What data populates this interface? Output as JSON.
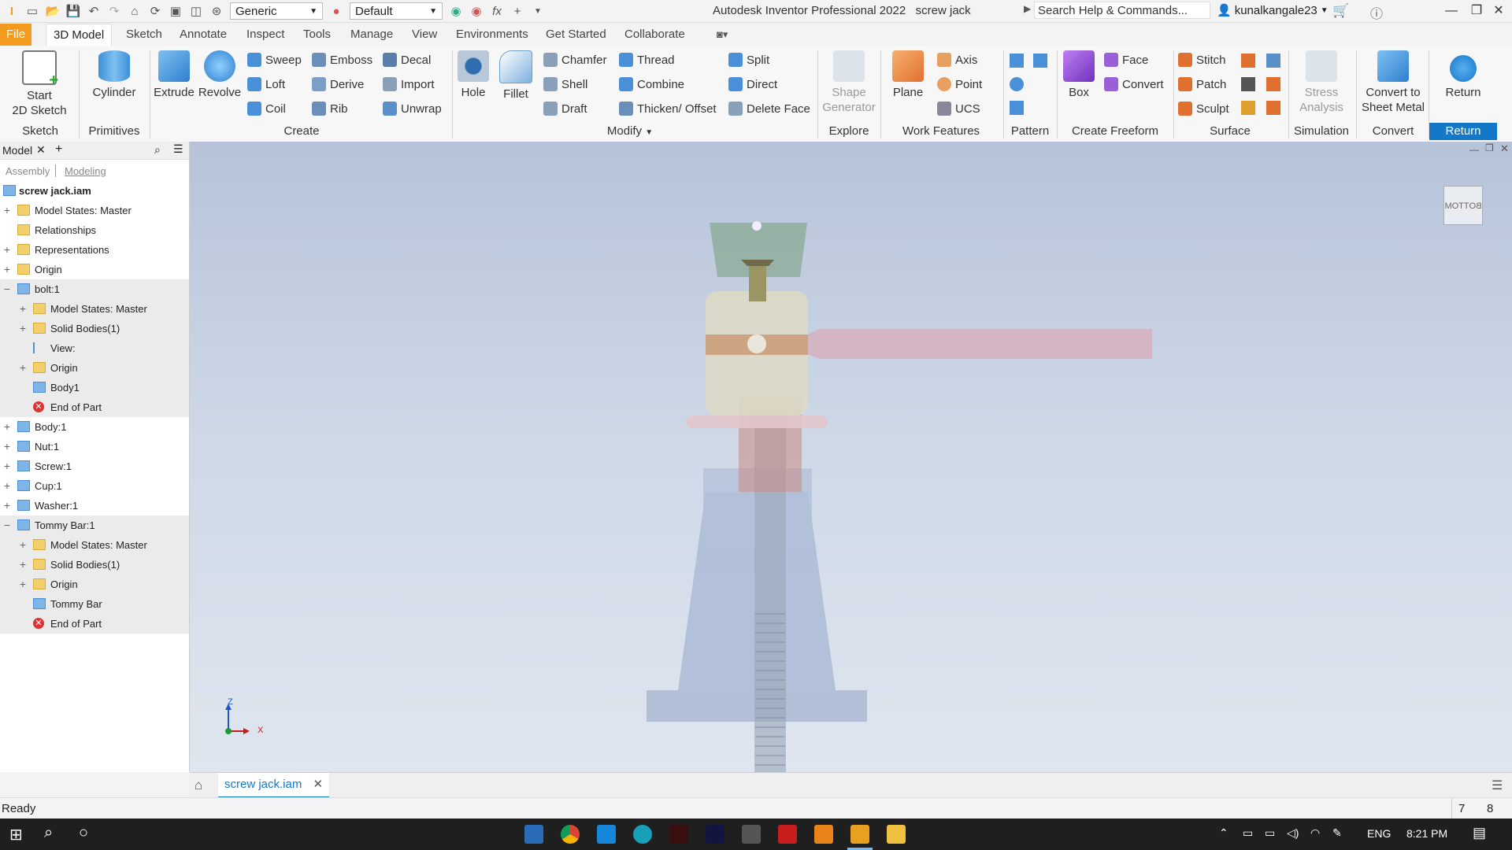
{
  "title_bar": {
    "material": "Generic",
    "appearance": "Default",
    "app_title": "Autodesk Inventor Professional 2022",
    "document": "screw jack",
    "search_placeholder": "Search Help & Commands...",
    "user": "kunalkangale23",
    "fx": "fx"
  },
  "menu_tabs": [
    "File",
    "3D Model",
    "Sketch",
    "Annotate",
    "Inspect",
    "Tools",
    "Manage",
    "View",
    "Environments",
    "Get Started",
    "Collaborate"
  ],
  "active_tab": "3D Model",
  "ribbon": {
    "sketch": {
      "start_sketch_line1": "Start",
      "start_sketch_line2": "2D Sketch",
      "group": "Sketch"
    },
    "primitives": {
      "cylinder": "Cylinder",
      "group": "Primitives"
    },
    "create": {
      "extrude": "Extrude",
      "revolve": "Revolve",
      "sweep": "Sweep",
      "emboss": "Emboss",
      "decal": "Decal",
      "loft": "Loft",
      "derive": "Derive",
      "import": "Import",
      "coil": "Coil",
      "rib": "Rib",
      "unwrap": "Unwrap",
      "group": "Create"
    },
    "modify": {
      "hole": "Hole",
      "fillet": "Fillet",
      "chamfer": "Chamfer",
      "thread": "Thread",
      "split": "Split",
      "shell": "Shell",
      "combine": "Combine",
      "direct": "Direct",
      "draft": "Draft",
      "thicken": "Thicken/ Offset",
      "delete_face": "Delete Face",
      "group": "Modify"
    },
    "explore": {
      "shape_gen_1": "Shape",
      "shape_gen_2": "Generator",
      "group": "Explore"
    },
    "work_features": {
      "plane": "Plane",
      "axis": "Axis",
      "point": "Point",
      "ucs": "UCS",
      "group": "Work Features"
    },
    "pattern": {
      "group": "Pattern"
    },
    "freeform": {
      "box": "Box",
      "face": "Face",
      "convert": "Convert",
      "group": "Create Freeform"
    },
    "surface": {
      "stitch": "Stitch",
      "patch": "Patch",
      "sculpt": "Sculpt",
      "group": "Surface"
    },
    "simulation": {
      "stress_1": "Stress",
      "stress_2": "Analysis",
      "group": "Simulation"
    },
    "convert": {
      "line1": "Convert to",
      "line2": "Sheet Metal",
      "group": "Convert"
    },
    "return": {
      "label": "Return",
      "group": "Return"
    }
  },
  "browser": {
    "tab": "Model",
    "sub_assembly": "Assembly",
    "sub_modeling": "Modeling",
    "root": "screw jack.iam",
    "items": [
      {
        "label": "Model States: Master",
        "level": 0,
        "exp": "+",
        "icon": "folder"
      },
      {
        "label": "Relationships",
        "level": 0,
        "exp": "",
        "icon": "folder"
      },
      {
        "label": "Representations",
        "level": 0,
        "exp": "+",
        "icon": "folder"
      },
      {
        "label": "Origin",
        "level": 0,
        "exp": "+",
        "icon": "folder"
      },
      {
        "label": "bolt:1",
        "level": 0,
        "exp": "−",
        "icon": "part"
      },
      {
        "label": "Model States: Master",
        "level": 1,
        "exp": "+",
        "icon": "folder"
      },
      {
        "label": "Solid Bodies(1)",
        "level": 1,
        "exp": "+",
        "icon": "folder"
      },
      {
        "label": "View:",
        "level": 1,
        "exp": "",
        "icon": "view"
      },
      {
        "label": "Origin",
        "level": 1,
        "exp": "+",
        "icon": "folder"
      },
      {
        "label": "Body1",
        "level": 1,
        "exp": "",
        "icon": "part"
      },
      {
        "label": "End of Part",
        "level": 1,
        "exp": "",
        "icon": "end"
      },
      {
        "label": "Body:1",
        "level": 0,
        "exp": "+",
        "icon": "part"
      },
      {
        "label": "Nut:1",
        "level": 0,
        "exp": "+",
        "icon": "part"
      },
      {
        "label": "Screw:1",
        "level": 0,
        "exp": "+",
        "icon": "part"
      },
      {
        "label": "Cup:1",
        "level": 0,
        "exp": "+",
        "icon": "part"
      },
      {
        "label": "Washer:1",
        "level": 0,
        "exp": "+",
        "icon": "part"
      },
      {
        "label": "Tommy Bar:1",
        "level": 0,
        "exp": "−",
        "icon": "part"
      },
      {
        "label": "Model States: Master",
        "level": 1,
        "exp": "+",
        "icon": "folder"
      },
      {
        "label": "Solid Bodies(1)",
        "level": 1,
        "exp": "+",
        "icon": "folder"
      },
      {
        "label": "Origin",
        "level": 1,
        "exp": "+",
        "icon": "folder"
      },
      {
        "label": "Tommy Bar",
        "level": 1,
        "exp": "",
        "icon": "part"
      },
      {
        "label": "End of Part",
        "level": 1,
        "exp": "",
        "icon": "end"
      }
    ]
  },
  "viewport": {
    "viewcube_face": "BOTTOM",
    "axis_z": "Z",
    "axis_x": "X"
  },
  "doc_tab": "screw jack.iam",
  "status": {
    "text": "Ready",
    "num1": "7",
    "num2": "8"
  },
  "taskbar": {
    "lang": "ENG",
    "time": "8:21 PM"
  },
  "colors": {
    "file_tab": "#f39b1e",
    "accent": "#1478c8",
    "return_blue": "#1478c8"
  }
}
